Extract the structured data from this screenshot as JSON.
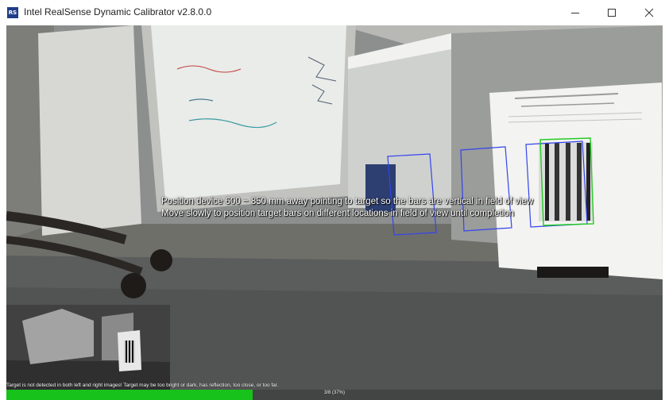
{
  "window": {
    "title": "Intel RealSense Dynamic Calibrator v2.8.0.0",
    "app_icon_text": "RS",
    "controls": [
      "minimize-icon",
      "maximize-icon",
      "close-icon"
    ]
  },
  "instructions": {
    "line1": "Position device 600 ~ 850 mm away pointing to target so the bars are vertical in field of view",
    "line2": "Move slowly to position target bars on different locations in field of view until completion"
  },
  "status": {
    "message": "Target is not detected in both left and right images! Target may be too bright or dark, has reflection, too close, or too far.",
    "progress_label": "3/8 (37%)",
    "progress_fraction": 0.375,
    "progress_color": "#17c21a"
  },
  "target_box_color": "#3344ee",
  "target_detect_color": "#22cc22"
}
